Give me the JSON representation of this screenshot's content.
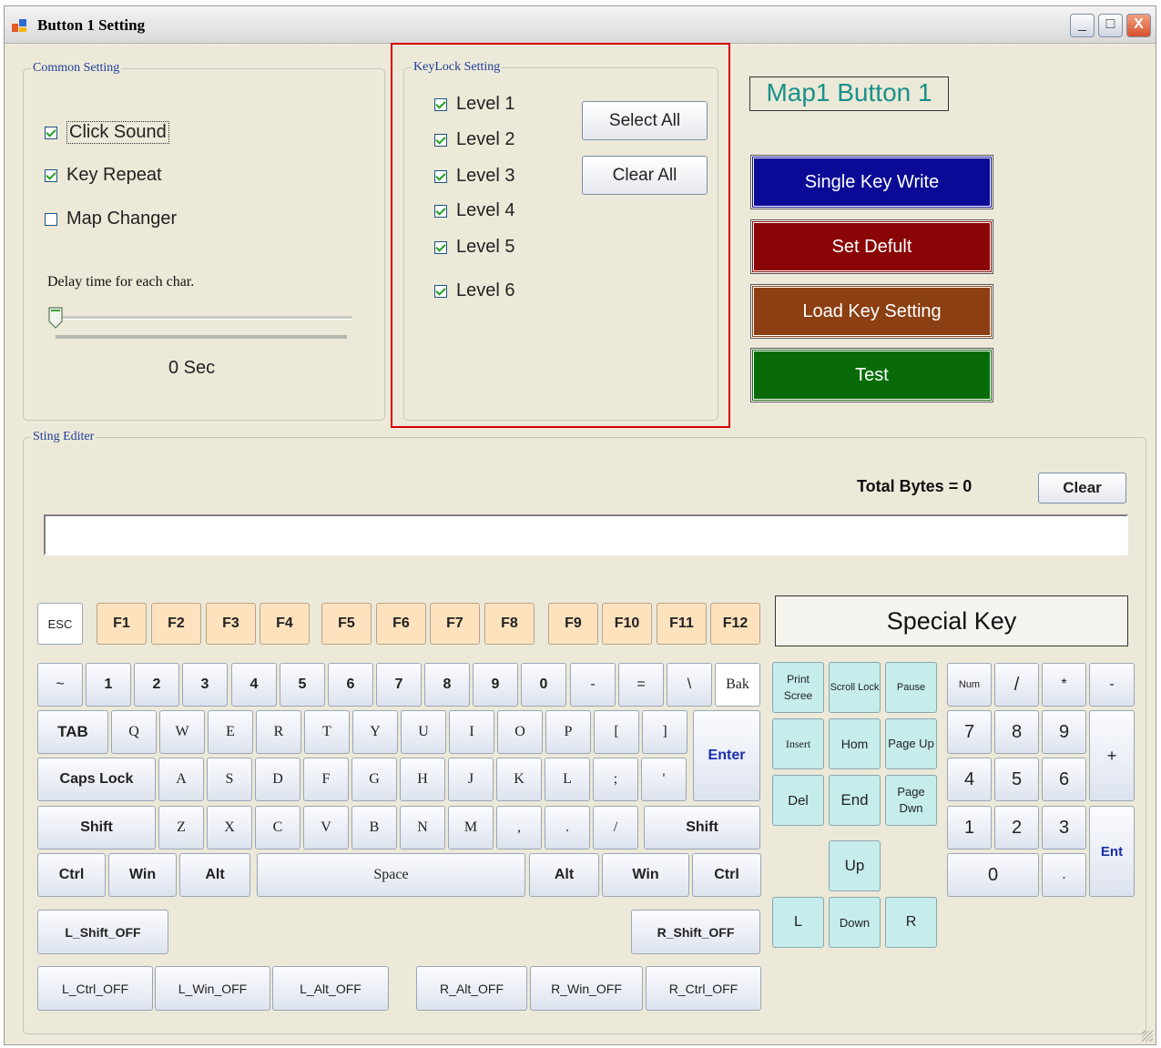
{
  "window": {
    "title": "Button 1 Setting",
    "controls": [
      "_",
      "□",
      "X"
    ]
  },
  "common": {
    "label": "Common Setting",
    "click_sound": {
      "label": "Click Sound",
      "checked": true
    },
    "key_repeat": {
      "label": "Key Repeat",
      "checked": true
    },
    "map_changer": {
      "label": "Map Changer",
      "checked": false
    },
    "delay_label": "Delay time for each char.",
    "delay_value": "0 Sec",
    "slider_value": 0
  },
  "keylock": {
    "label": "KeyLock Setting",
    "levels": [
      {
        "label": "Level 1",
        "checked": true
      },
      {
        "label": "Level 2",
        "checked": true
      },
      {
        "label": "Level 3",
        "checked": true
      },
      {
        "label": "Level 4",
        "checked": true
      },
      {
        "label": "Level 5",
        "checked": true
      },
      {
        "label": "Level 6",
        "checked": true
      }
    ],
    "select_all": "Select All",
    "clear_all": "Clear All",
    "highlight_color": "#d40000"
  },
  "map_label": "Map1 Button 1",
  "actions": {
    "single_key_write": {
      "label": "Single Key Write",
      "color": "#0a0a96"
    },
    "set_default": {
      "label": "Set Defult",
      "color": "#8a0505"
    },
    "load_key_setting": {
      "label": "Load Key Setting",
      "color": "#8b3f12"
    },
    "test": {
      "label": "Test",
      "color": "#086b08"
    }
  },
  "string_editor": {
    "label": "Sting Editer",
    "total_bytes": "Total Bytes = 0",
    "clear": "Clear",
    "input_value": ""
  },
  "special_key_title": "Special Key",
  "keys": {
    "esc": "ESC",
    "f": [
      "F1",
      "F2",
      "F3",
      "F4",
      "F5",
      "F6",
      "F7",
      "F8",
      "F9",
      "F10",
      "F11",
      "F12"
    ],
    "row1": [
      "~",
      "1",
      "2",
      "3",
      "4",
      "5",
      "6",
      "7",
      "8",
      "9",
      "0",
      "-",
      "=",
      "\\",
      "Bak"
    ],
    "tab": "TAB",
    "row2": [
      "Q",
      "W",
      "E",
      "R",
      "T",
      "Y",
      "U",
      "I",
      "O",
      "P",
      "[",
      "]"
    ],
    "enter": "Enter",
    "caps": "Caps Lock",
    "row3": [
      "A",
      "S",
      "D",
      "F",
      "G",
      "H",
      "J",
      "K",
      "L",
      ";",
      "'"
    ],
    "shift_l": "Shift",
    "row4": [
      "Z",
      "X",
      "C",
      "V",
      "B",
      "N",
      "M",
      ",",
      ".",
      "/"
    ],
    "shift_r": "Shift",
    "ctrl_l": "Ctrl",
    "win_l": "Win",
    "alt_l": "Alt",
    "space": "Space",
    "alt_r": "Alt",
    "win_r": "Win",
    "ctrl_r": "Ctrl",
    "l_shift_off": "L_Shift_OFF",
    "r_shift_off": "R_Shift_OFF",
    "l_ctrl_off": "L_Ctrl_OFF",
    "l_win_off": "L_Win_OFF",
    "l_alt_off": "L_Alt_OFF",
    "r_alt_off": "R_Alt_OFF",
    "r_win_off": "R_Win_OFF",
    "r_ctrl_off": "R_Ctrl_OFF"
  },
  "special": {
    "print": "Print Scree",
    "scroll": "Scroll Lock",
    "pause": "Pause",
    "insert": "Insert",
    "home": "Hom",
    "pageup": "Page Up",
    "del": "Del",
    "end": "End",
    "pagedown": "Page Dwn",
    "up": "Up",
    "left": "L",
    "down": "Down",
    "right": "R"
  },
  "numpad": {
    "num": "Num",
    "div": "/",
    "mul": "*",
    "minus": "-",
    "n7": "7",
    "n8": "8",
    "n9": "9",
    "plus": "+",
    "n4": "4",
    "n5": "5",
    "n6": "6",
    "n1": "1",
    "n2": "2",
    "n3": "3",
    "ent": "Ent",
    "n0": "0",
    "dot": "."
  }
}
